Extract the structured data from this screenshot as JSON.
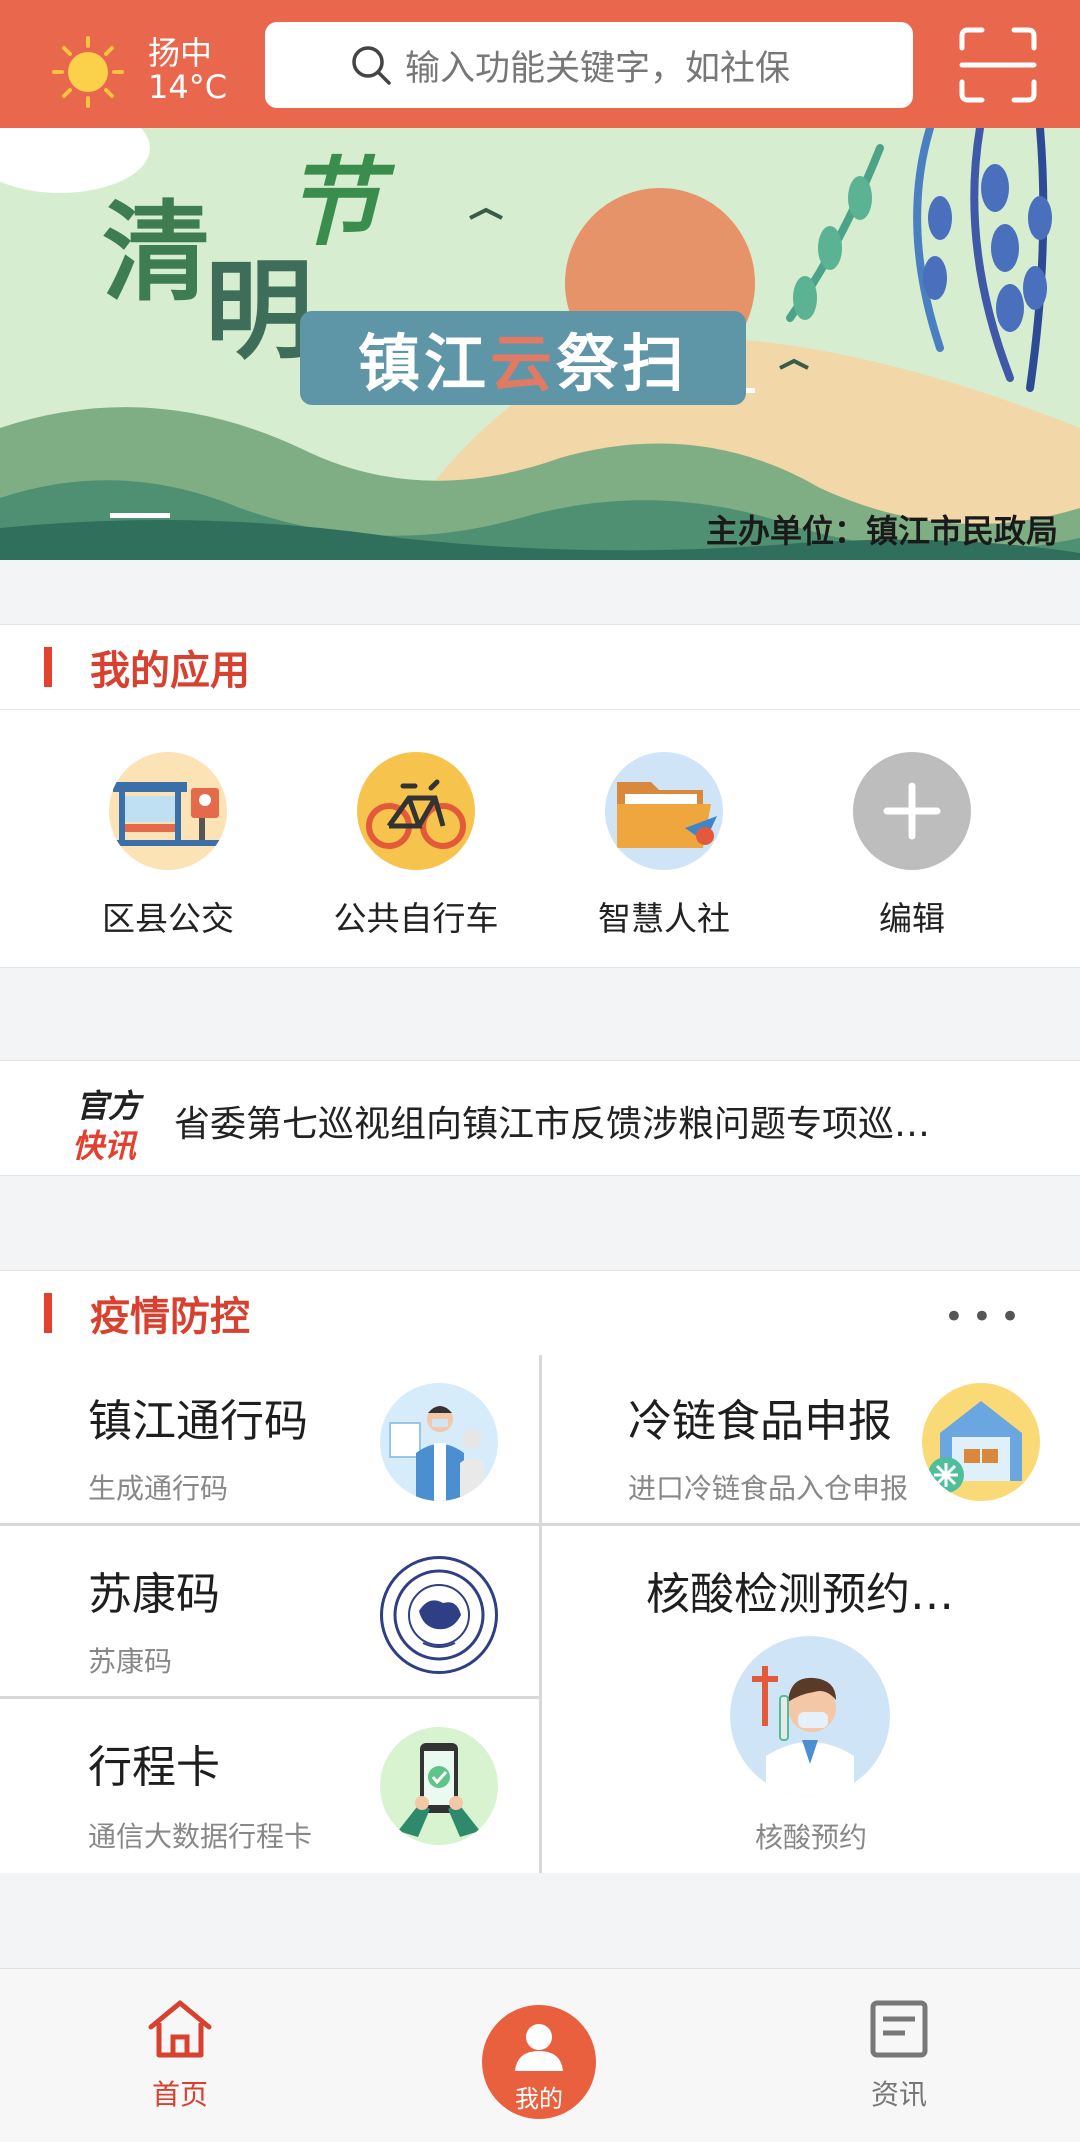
{
  "header": {
    "weather_city": "扬中",
    "weather_temp": "14°C",
    "search_placeholder": "输入功能关键字，如社保",
    "scan_icon": "scan-icon",
    "bg_color": "#e8674d"
  },
  "banner": {
    "title_char1": "清",
    "title_char2": "明",
    "title_char3": "节",
    "subtitle_a": "镇江",
    "subtitle_b": "云",
    "subtitle_c": "祭扫",
    "sponsor": "主办单位：镇江市民政局"
  },
  "my_apps": {
    "title": "我的应用",
    "items": [
      {
        "label": "区县公交",
        "icon": "bus-stop-icon"
      },
      {
        "label": "公共自行车",
        "icon": "bicycle-icon"
      },
      {
        "label": "智慧人社",
        "icon": "folder-icon"
      },
      {
        "label": "编辑",
        "icon": "plus-icon"
      }
    ]
  },
  "news": {
    "logo_line1": "官方",
    "logo_line2": "快讯",
    "headline": "省委第七巡视组向镇江市反馈涉粮问题专项巡…"
  },
  "epidemic": {
    "title": "疫情防控",
    "more": "•••",
    "cells": [
      {
        "title": "镇江通行码",
        "sub": "生成通行码",
        "icon": "doctor-icon"
      },
      {
        "title": "冷链食品申报",
        "sub": "进口冷链食品入仓申报",
        "icon": "cold-storage-icon"
      },
      {
        "title": "苏康码",
        "sub": "苏康码",
        "icon": "cdc-seal-icon"
      },
      {
        "title": "核酸检测预约…",
        "sub": "核酸预约",
        "icon": "nurse-icon"
      },
      {
        "title": "行程卡",
        "sub": "通信大数据行程卡",
        "icon": "phone-check-icon"
      }
    ]
  },
  "tabbar": {
    "home": "首页",
    "mine": "我的",
    "news": "资讯",
    "active_color": "#d8412f"
  }
}
